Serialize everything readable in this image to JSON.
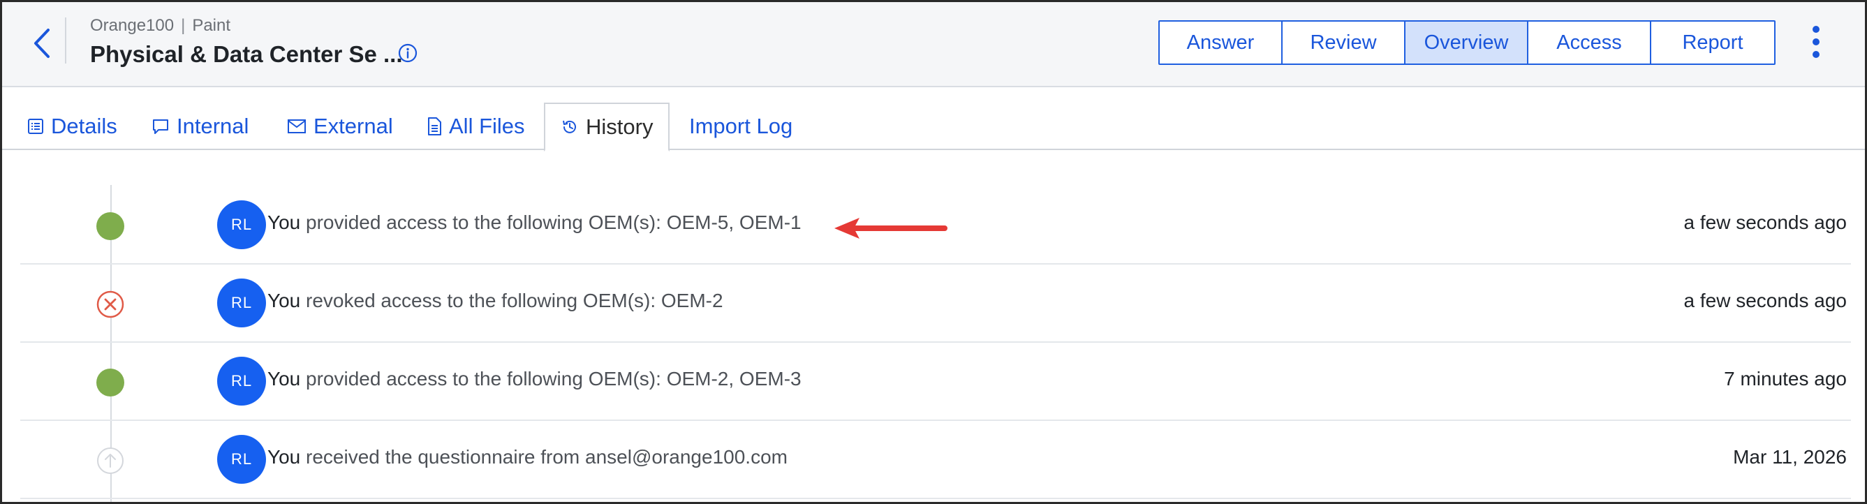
{
  "header": {
    "breadcrumb": {
      "org": "Orange100",
      "separator": "|",
      "section": "Paint"
    },
    "title": "Physical & Data Center Se ..."
  },
  "view_switch": {
    "items": [
      "Answer",
      "Review",
      "Overview",
      "Access",
      "Report"
    ],
    "active": "Overview"
  },
  "tabs": [
    {
      "label": "Details",
      "icon": "list-icon"
    },
    {
      "label": "Internal",
      "icon": "comment-icon"
    },
    {
      "label": "External",
      "icon": "mail-icon"
    },
    {
      "label": "All Files",
      "icon": "file-icon"
    },
    {
      "label": "History",
      "icon": "history-icon",
      "active": true
    },
    {
      "label": "Import Log"
    }
  ],
  "history": [
    {
      "status": "granted",
      "avatar": "RL",
      "actor": "You",
      "message": " provided access to the following OEM(s): OEM-5, OEM-1",
      "time": "a few seconds ago"
    },
    {
      "status": "revoked",
      "avatar": "RL",
      "actor": "You",
      "message": " revoked access to the following OEM(s): OEM-2",
      "time": "a few seconds ago"
    },
    {
      "status": "granted",
      "avatar": "RL",
      "actor": "You",
      "message": " provided access to the following OEM(s): OEM-2, OEM-3",
      "time": "7 minutes ago"
    },
    {
      "status": "received",
      "avatar": "RL",
      "actor": "You",
      "message": " received the questionnaire from ansel@orange100.com",
      "time": "Mar 11, 2026"
    }
  ],
  "colors": {
    "accent": "#1a56db",
    "active_segment": "#d3e1fb",
    "granted": "#7fad4c",
    "revoked": "#e05a47",
    "avatar": "#1660f0",
    "annotation_arrow": "#e53935"
  }
}
